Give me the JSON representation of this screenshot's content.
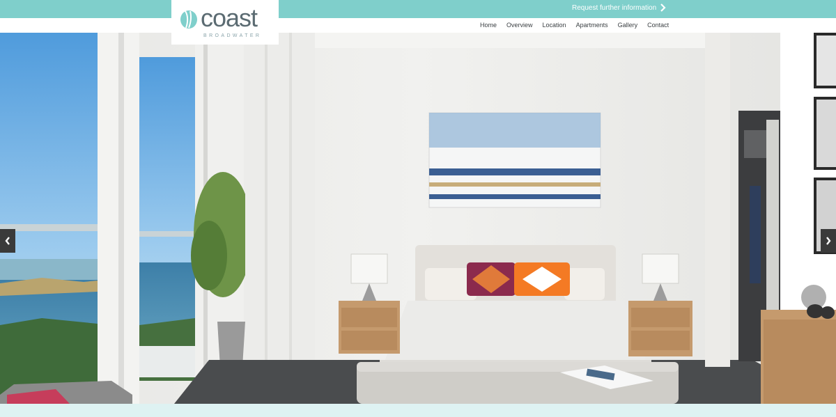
{
  "header": {
    "request_link": "Request further information",
    "logo": {
      "wordmark": "coast",
      "subtitle": "BROADWATER"
    }
  },
  "nav": {
    "items": [
      "Home",
      "Overview",
      "Location",
      "Apartments",
      "Gallery",
      "Contact"
    ]
  },
  "hero": {
    "slider_prev": "chevron-left-icon",
    "slider_next": "chevron-right-icon"
  },
  "colors": {
    "accent": "#7fcfcb",
    "footer_strip": "#def2f2",
    "logo_text": "#5b6b72"
  }
}
